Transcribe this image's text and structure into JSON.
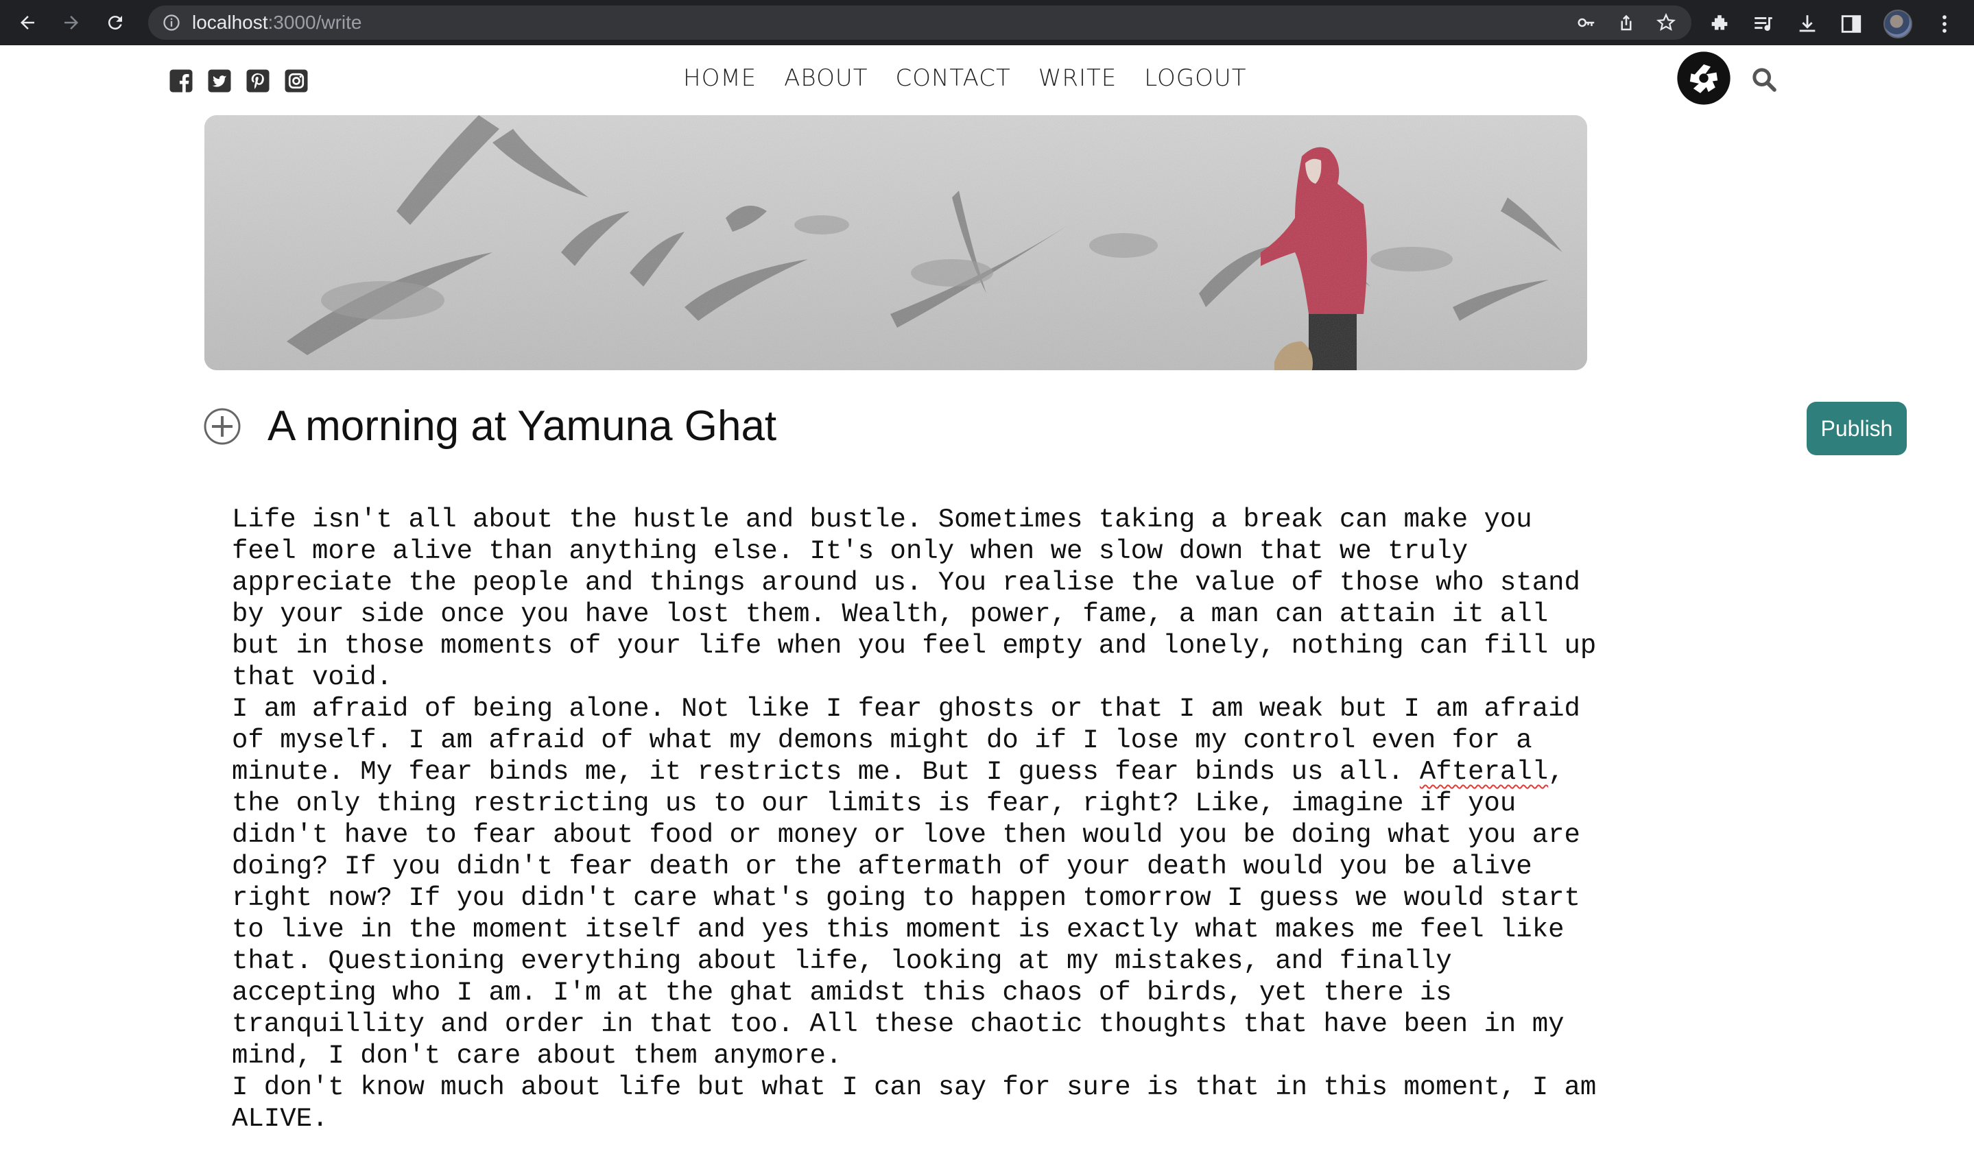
{
  "browser": {
    "url_host": "localhost",
    "url_path": ":3000/write"
  },
  "header": {
    "social_icons": [
      "facebook-icon",
      "twitter-icon",
      "pinterest-icon",
      "instagram-icon"
    ],
    "nav": [
      "HOME",
      "ABOUT",
      "CONTACT",
      "WRITE",
      "LOGOUT"
    ]
  },
  "editor": {
    "title": "A morning at Yamuna Ghat",
    "publish_label": "Publish",
    "body": {
      "p1": "Life isn't all about the hustle and bustle. Sometimes taking a break can make you feel more alive than anything else. It's only when we slow down that we truly appreciate the people and things around us. You realise the value of those who stand by your side once you have lost them. Wealth, power, fame, a man can attain it all but in those moments of your life when you feel empty and lonely, nothing can fill up that void.",
      "p2_start": "I am afraid of being alone. Not like I fear ghosts or that I am weak but I am afraid of myself. I am afraid of what my demons might do if I lose my control even for a minute. My fear binds me, it restricts me. But I guess fear binds us all.",
      "p2_misspelled": "Afterall",
      "p2_rest": ", the only thing restricting us to our limits is fear, right? Like, imagine if you didn't have to fear about food or money or love then would you be doing what you are doing? If you didn't fear death or the aftermath of your death would you be alive right now? If you didn't care what's going to happen tomorrow I guess we would start to live in the moment itself and yes this moment is exactly what makes me feel like that. Questioning everything about life, looking at my mistakes, and finally accepting who I am. I'm at the ghat amidst this chaos of birds, yet there is tranquillity and order in that too. All these chaotic thoughts that have been in my mind, I don't care about them anymore.",
      "p3": "I don't know much about life but what I can say for sure is that in this moment, I am ALIVE."
    }
  },
  "colors": {
    "publish_bg": "#2f7f7c",
    "chrome_bg": "#202124"
  }
}
